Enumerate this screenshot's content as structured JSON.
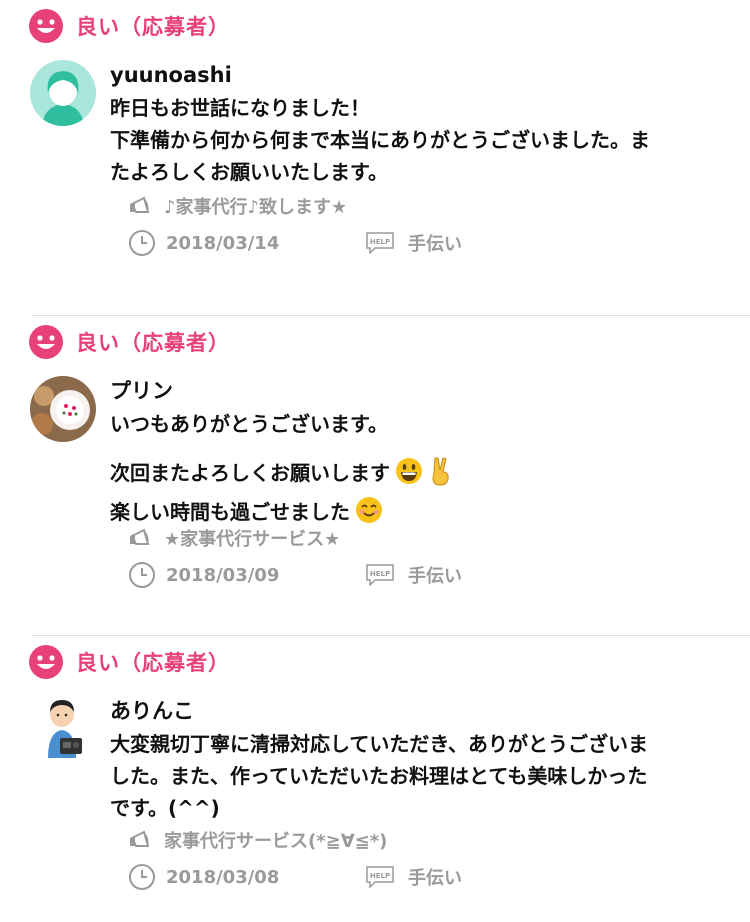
{
  "reviews": [
    {
      "rating_label": "良い（応募者）",
      "username": "yuunoashi",
      "comment_lines": [
        "昨日もお世話になりました！",
        "下準備から何から何まで本当にありがとうございました。ま",
        "たよろしくお願いいたします。"
      ],
      "job_title": "♪家事代行♪致します★",
      "date": "2018/03/14",
      "category": "手伝い"
    },
    {
      "rating_label": "良い（応募者）",
      "username": "プリン",
      "comment_lines": [
        "いつもありがとうございます。",
        "",
        "次回またよろしくお願いします",
        "楽しい時間も過ごせました"
      ],
      "job_title": "★家事代行サービス★",
      "date": "2018/03/09",
      "category": "手伝い"
    },
    {
      "rating_label": "良い（応募者）",
      "username": "ありんこ",
      "comment_lines": [
        "大変親切丁寧に清掃対応していただき、ありがとうございま",
        "した。また、作っていただいたお料理はとても美味しかった",
        "です。(^^)"
      ],
      "job_title": "家事代行サービス(*≧∀≦*)",
      "date": "2018/03/08",
      "category": "手伝い"
    }
  ],
  "icons": {
    "rating": "smile-icon",
    "job": "megaphone-icon",
    "date": "clock-icon",
    "category": "help-icon"
  },
  "colors": {
    "accent": "#e8417a",
    "meta_text": "#9a9a9a"
  }
}
